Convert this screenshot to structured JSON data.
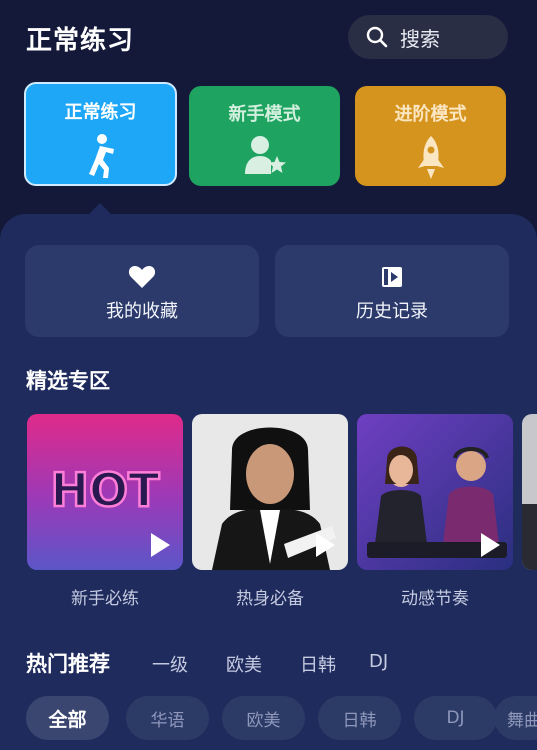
{
  "header": {
    "title": "正常练习",
    "search_label": "搜索"
  },
  "modes": [
    {
      "label": "正常练习",
      "icon": "runner-icon",
      "color": "#1ea7f6"
    },
    {
      "label": "新手模式",
      "icon": "user-star-icon",
      "color": "#1ea360"
    },
    {
      "label": "进阶模式",
      "icon": "rocket-icon",
      "color": "#d5941e"
    }
  ],
  "quick": [
    {
      "label": "我的收藏",
      "icon": "heart-icon"
    },
    {
      "label": "历史记录",
      "icon": "history-play-icon"
    }
  ],
  "featured": {
    "title": "精选专区",
    "items": [
      {
        "caption": "新手必练",
        "image_text": "HOT"
      },
      {
        "caption": "热身必备"
      },
      {
        "caption": "动感节奏"
      }
    ]
  },
  "hot": {
    "title": "热门推荐",
    "filters": [
      "一级",
      "欧美",
      "日韩",
      "DJ"
    ],
    "chips": [
      "全部",
      "华语",
      "欧美",
      "日韩",
      "DJ",
      "舞曲"
    ]
  }
}
